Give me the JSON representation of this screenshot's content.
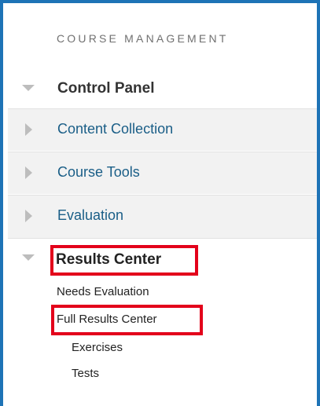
{
  "section": {
    "title": "COURSE MANAGEMENT"
  },
  "control_panel": {
    "label": "Control Panel",
    "items": [
      {
        "label": "Content Collection"
      },
      {
        "label": "Course Tools"
      },
      {
        "label": "Evaluation"
      }
    ]
  },
  "results_center": {
    "label": "Results Center",
    "highlight_color": "#e3001b",
    "links": [
      {
        "label": "Needs Evaluation"
      },
      {
        "label": "Full Results Center"
      },
      {
        "label": "Exercises"
      },
      {
        "label": "Tests"
      }
    ]
  },
  "colors": {
    "frame_border": "#1e73b6",
    "link_blue": "#1a5e87",
    "row_bg": "#f2f2f2"
  }
}
